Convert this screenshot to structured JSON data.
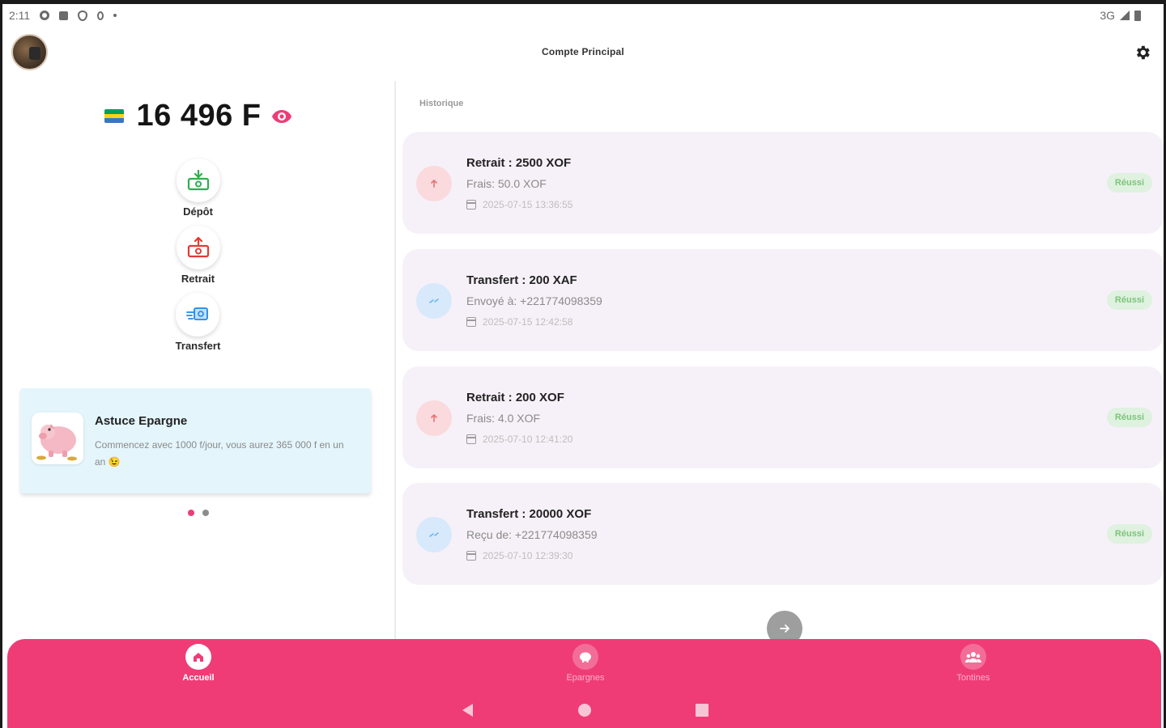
{
  "status_bar": {
    "time": "2:11",
    "network": "3G"
  },
  "app_bar": {
    "title": "Compte Principal",
    "avatar_icon": "user-avatar",
    "settings_icon": "gear-icon"
  },
  "balance": {
    "amount": "16 496 F",
    "flag": "gabon-flag",
    "visibility_icon": "eye-icon",
    "flag_colors": [
      "#009e60",
      "#fcd116",
      "#3a75c4"
    ]
  },
  "actions": [
    {
      "label": "Dépôt",
      "icon": "deposit-icon",
      "color": "#2fae4f"
    },
    {
      "label": "Retrait",
      "icon": "withdraw-icon",
      "color": "#e53935"
    },
    {
      "label": "Transfert",
      "icon": "transfer-icon",
      "color": "#1e88e5"
    }
  ],
  "tip": {
    "title": "Astuce Epargne",
    "text": "Commencez avec 1000 f/jour, vous aurez 365 000 f en un an 😉",
    "image": "piggy-bank-image"
  },
  "carousel": {
    "page_count": 2,
    "active_index": 0
  },
  "history": {
    "title": "Historique",
    "transactions": [
      {
        "title": "Retrait : 2500 XOF",
        "subtitle": "Frais: 50.0 XOF",
        "date": "2025-07-15 13:36:55",
        "status": "Réussi",
        "type": "withdrawal",
        "icon": "arrow-up-icon"
      },
      {
        "title": "Transfert : 200 XAF",
        "subtitle": "Envoyé à: +221774098359",
        "date": "2025-07-15 12:42:58",
        "status": "Réussi",
        "type": "transfer",
        "icon": "swap-icon"
      },
      {
        "title": "Retrait : 200 XOF",
        "subtitle": "Frais: 4.0 XOF",
        "date": "2025-07-10 12:41:20",
        "status": "Réussi",
        "type": "withdrawal",
        "icon": "arrow-up-icon"
      },
      {
        "title": "Transfert : 20000 XOF",
        "subtitle": "Reçu de: +221774098359",
        "date": "2025-07-10 12:39:30",
        "status": "Réussi",
        "type": "transfer",
        "icon": "swap-icon"
      }
    ]
  },
  "bottom_nav": {
    "items": [
      {
        "label": "Accueil",
        "icon": "home-icon",
        "active": true
      },
      {
        "label": "Epargnes",
        "icon": "piggy-icon",
        "active": false
      },
      {
        "label": "Tontines",
        "icon": "group-icon",
        "active": false
      }
    ]
  },
  "colors": {
    "accent": "#ef3c77",
    "success_bg": "#dff1df",
    "success_text": "#7cc47c",
    "card_bg": "#f6f1f8",
    "tip_bg": "#e4f5fb"
  }
}
